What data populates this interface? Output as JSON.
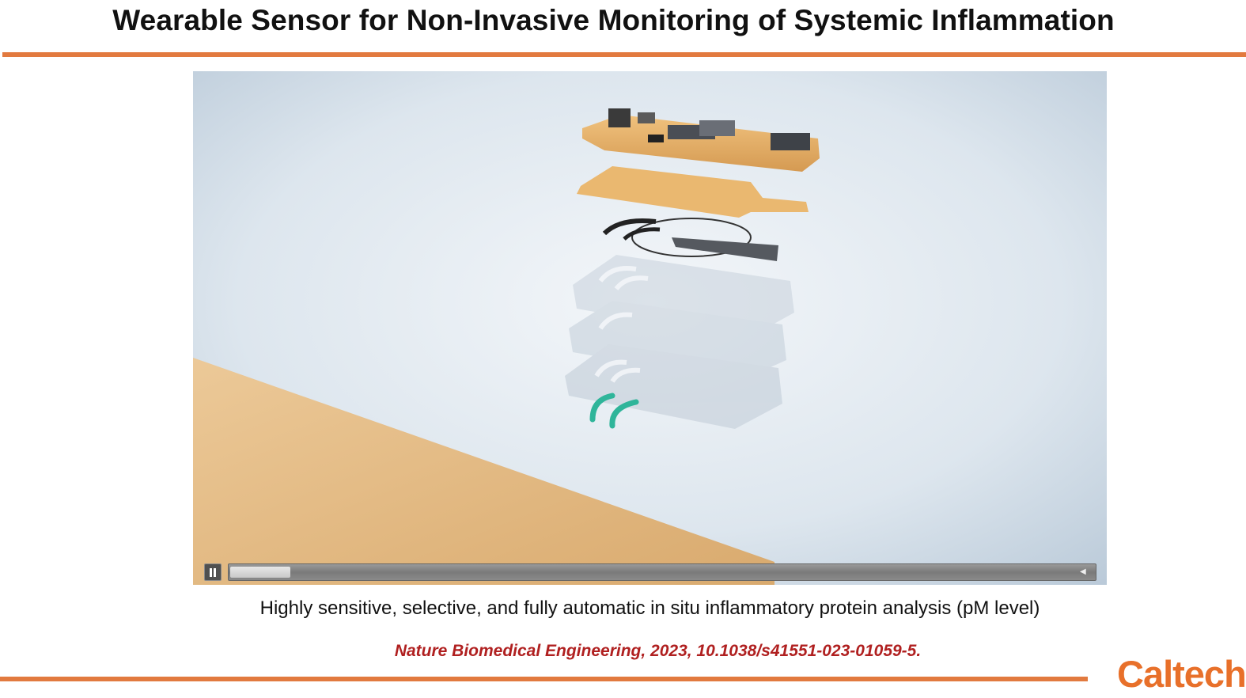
{
  "slide": {
    "title": "Wearable Sensor for Non-Invasive Monitoring of Systemic Inflammation",
    "caption": "Highly sensitive, selective, and fully automatic in situ inflammatory protein analysis (pM level)",
    "citation": "Nature Biomedical Engineering, 2023, 10.1038/s41551-023-01059-5.",
    "logo": "Caltech"
  },
  "video": {
    "state": "playing",
    "progress_fraction": 0.07,
    "controls": {
      "pause_icon": "pause-icon",
      "volume_icon": "volume-icon"
    }
  },
  "colors": {
    "accent_rule": "#e27a3f",
    "citation": "#b02020",
    "logo": "#e8702a"
  }
}
